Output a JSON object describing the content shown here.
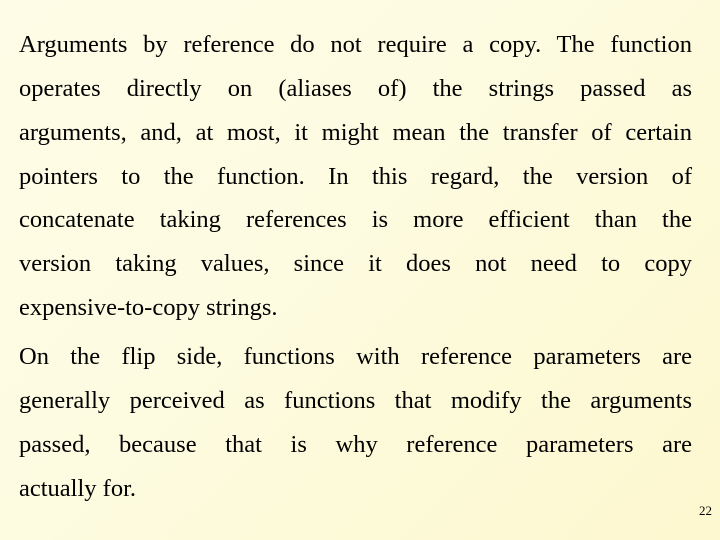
{
  "slide": {
    "paragraphs": [
      {
        "lines": [
          "Arguments by reference do not require a copy. The function",
          "operates directly on (aliases of) the strings passed as",
          "arguments, and, at most, it might mean the transfer of certain",
          "pointers to the function. In this regard, the version of",
          "concatenate taking references is more efficient than the",
          "version taking values, since it does not need to copy",
          "expensive-to-copy strings."
        ]
      },
      {
        "lines": [
          "On the flip side, functions with reference parameters are",
          "generally perceived as functions that modify the arguments",
          "passed, because that is why reference parameters are",
          "actually for."
        ]
      }
    ],
    "page_number": "22"
  }
}
